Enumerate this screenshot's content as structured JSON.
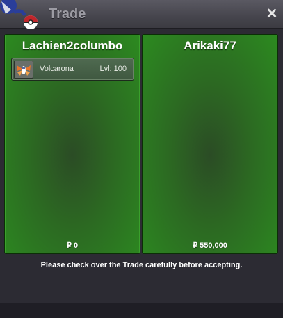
{
  "window": {
    "title": "Trade",
    "close_glyph": "✕"
  },
  "trade": {
    "left": {
      "player": "Lachien2columbo",
      "items": [
        {
          "pokemon": "Volcarona",
          "level": "Lvl: 100",
          "icon": "volcarona-icon"
        }
      ],
      "money": "₽ 0"
    },
    "right": {
      "player": "Arikaki77",
      "items": [],
      "money": "₽ 550,000"
    }
  },
  "notice": "Please check over the Trade carefully before accepting."
}
